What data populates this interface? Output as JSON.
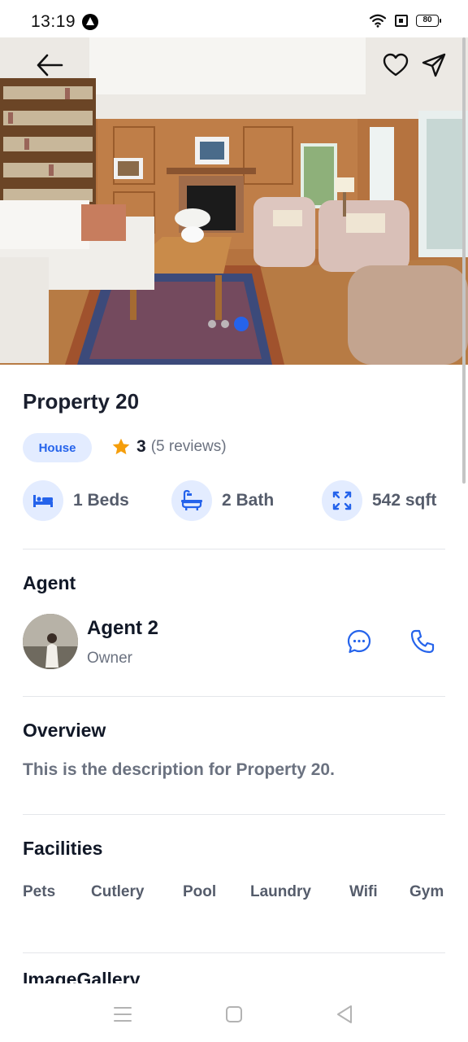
{
  "status_bar": {
    "time": "13:19",
    "battery": "80"
  },
  "hero": {
    "image_alt": "Living room photo",
    "carousel": {
      "count": 3,
      "active_index": 2
    }
  },
  "property": {
    "title": "Property 20",
    "type": "House",
    "rating": "3",
    "reviews": "(5 reviews)",
    "beds": "1 Beds",
    "baths": "2 Bath",
    "area": "542 sqft"
  },
  "agent": {
    "section_title": "Agent",
    "name": "Agent 2",
    "role": "Owner"
  },
  "overview": {
    "section_title": "Overview",
    "description": "This is the description for Property 20."
  },
  "facilities": {
    "section_title": "Facilities",
    "items": [
      "Pets",
      "Cutlery",
      "Pool",
      "Laundry",
      "Wifi",
      "Gym"
    ]
  },
  "gallery": {
    "section_title": "ImageGallery"
  },
  "colors": {
    "accent": "#2563eb",
    "badge_bg": "#e3ecff",
    "star": "#f59e0b",
    "title": "#1a1f2e",
    "muted": "#6b7280"
  },
  "icons": {
    "back": "arrow-left-icon",
    "favorite": "heart-icon",
    "share": "send-icon",
    "star": "star-icon",
    "beds": "bed-icon",
    "baths": "bathtub-icon",
    "area": "expand-icon",
    "message": "chat-bubble-icon",
    "call": "phone-icon",
    "nav_menu": "menu-icon",
    "nav_home": "square-icon",
    "nav_back": "triangle-back-icon"
  }
}
